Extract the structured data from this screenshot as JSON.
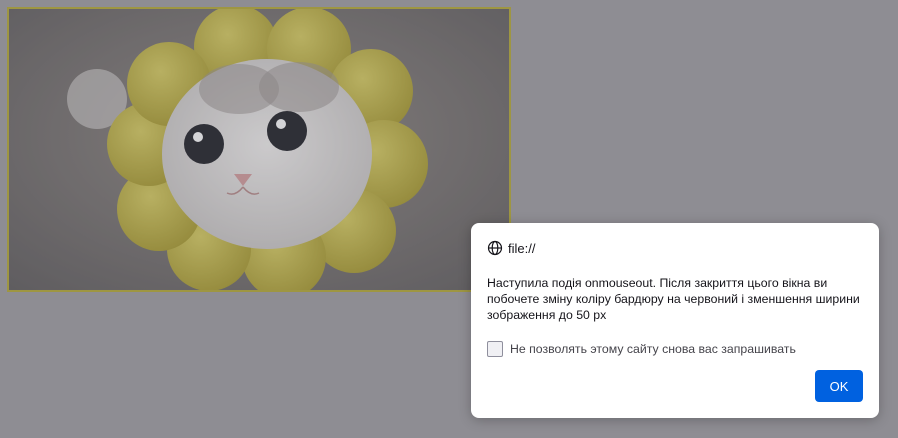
{
  "page": {
    "image_description": "cat-in-flower-costume"
  },
  "dialog": {
    "origin": "file://",
    "message": "Наступила подія onmouseout. Після закриття цього вікна ви побочете зміну колірy бардюру на червоний і зменшення ширини зображення до 50 px",
    "suppress_label": "Не позволять этому сайту снова вас запрашивать",
    "suppress_checked": false,
    "ok_label": "OK"
  },
  "colors": {
    "image_border": "#b5a931",
    "ok_button": "#0061e0",
    "backdrop": "#9e9da1"
  },
  "icons": {
    "origin_icon": "globe-icon"
  }
}
